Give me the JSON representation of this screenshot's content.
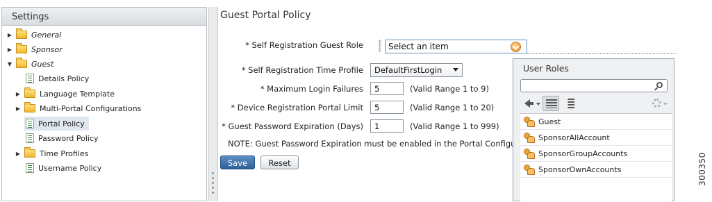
{
  "sidebar": {
    "title": "Settings",
    "items": [
      {
        "label": "General",
        "type": "folder",
        "expanded": false,
        "italic": true
      },
      {
        "label": "Sponsor",
        "type": "folder",
        "expanded": false,
        "italic": true
      },
      {
        "label": "Guest",
        "type": "folder",
        "expanded": true,
        "italic": true
      },
      {
        "label": "Details Policy",
        "type": "page"
      },
      {
        "label": "Language Template",
        "type": "folder",
        "expanded": false
      },
      {
        "label": "Multi-Portal Configurations",
        "type": "folder",
        "expanded": false
      },
      {
        "label": "Portal Policy",
        "type": "page",
        "selected": true
      },
      {
        "label": "Password Policy",
        "type": "page"
      },
      {
        "label": "Time Profiles",
        "type": "folder",
        "expanded": false
      },
      {
        "label": "Username Policy",
        "type": "page"
      }
    ]
  },
  "main": {
    "title": "Guest Portal Policy",
    "fields": {
      "guest_role": {
        "label": "* Self Registration Guest Role",
        "value": "Select an item"
      },
      "time_profile": {
        "label": "* Self Registration Time Profile",
        "value": "DefaultFirstLogin"
      },
      "max_login": {
        "label": "* Maximum Login Failures",
        "value": "5",
        "range": "(Valid Range 1 to 9)"
      },
      "device_limit": {
        "label": "* Device Registration Portal Limit",
        "value": "5",
        "range": "(Valid Range 1 to 20)"
      },
      "pw_expiration": {
        "label": "* Guest Password Expiration (Days)",
        "value": "1",
        "range": "(Valid Range 1 to 999)"
      }
    },
    "note": "NOTE: Guest Password Expiration must be enabled in the Portal Configuration",
    "save_label": "Save",
    "reset_label": "Reset"
  },
  "popup": {
    "title": "User Roles",
    "search_value": "",
    "roles": [
      "Guest",
      "SponsorAllAccount",
      "SponsorGroupAccounts",
      "SponsorOwnAccounts"
    ]
  },
  "side_number": "300350",
  "colors": {
    "accent": "#2d5f99",
    "picker_orange": "#e88a18",
    "selection": "#dfe6ee"
  }
}
